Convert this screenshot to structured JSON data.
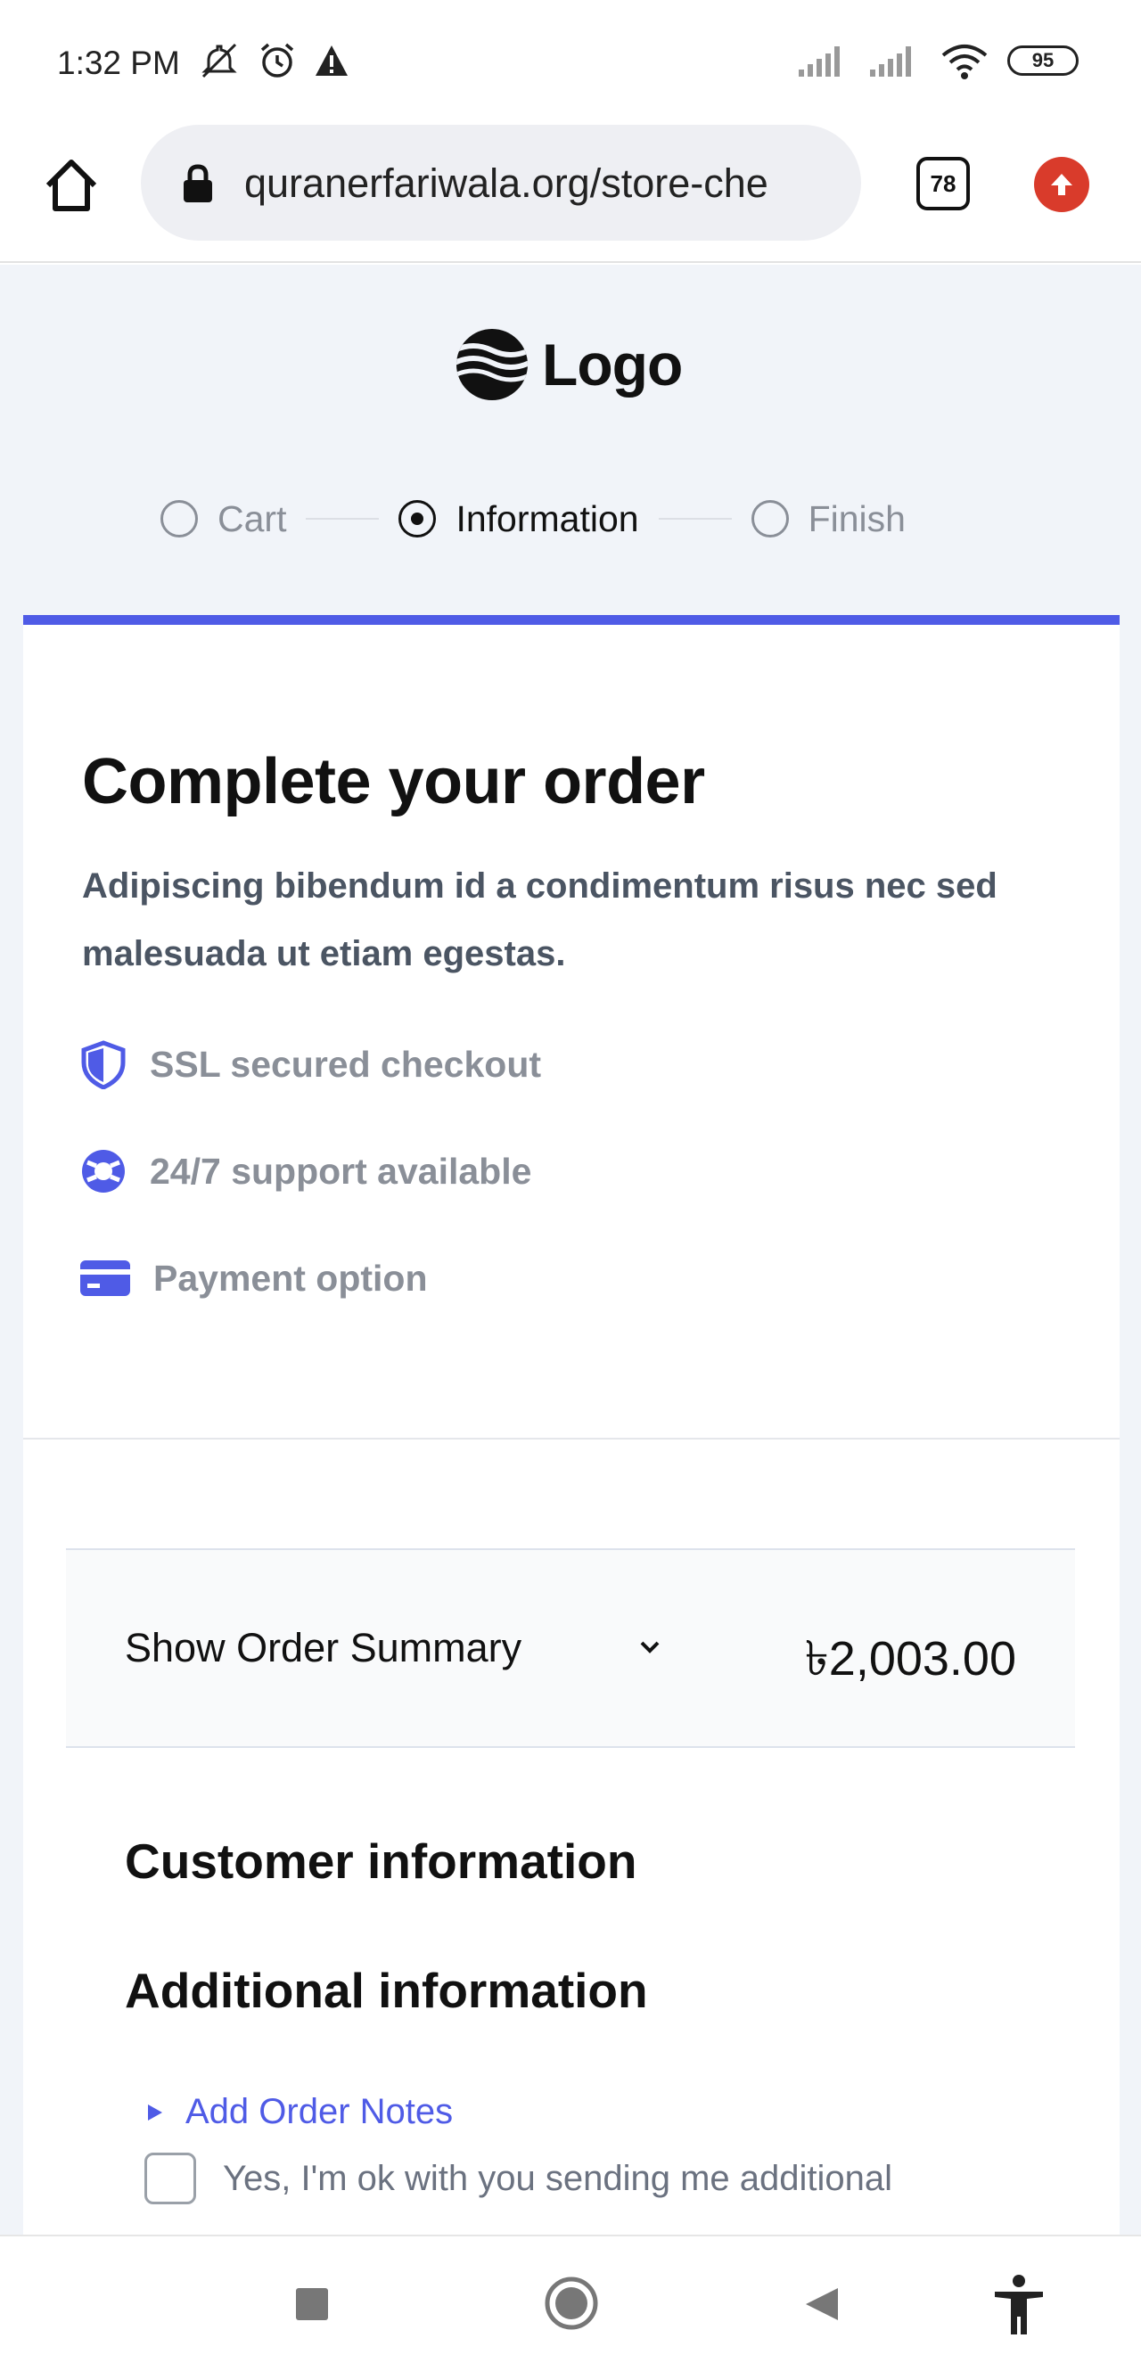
{
  "status_bar": {
    "time": "1:32 PM",
    "battery": "95"
  },
  "browser": {
    "url": "quranerfariwala.org/store-che",
    "tab_count": "78"
  },
  "logo": {
    "text": "Logo"
  },
  "steps": [
    {
      "label": "Cart",
      "active": false
    },
    {
      "label": "Information",
      "active": true
    },
    {
      "label": "Finish",
      "active": false
    }
  ],
  "checkout": {
    "title": "Complete your order",
    "subtitle": "Adipiscing bibendum id a condimentum risus nec sed malesuada ut etiam egestas.",
    "features": [
      {
        "label": "SSL secured checkout",
        "icon": "shield-icon"
      },
      {
        "label": "24/7 support available",
        "icon": "lifebuoy-icon"
      },
      {
        "label": "Payment option",
        "icon": "credit-card-icon"
      }
    ]
  },
  "summary": {
    "label": "Show Order Summary",
    "total": "৳2,003.00"
  },
  "sections": {
    "customer_info": "Customer information",
    "additional_info": "Additional information",
    "add_notes": "Add Order Notes",
    "consent": "Yes, I'm ok with you sending me additional"
  },
  "colors": {
    "accent": "#4f5be6",
    "page_bg": "#f1f4f9"
  }
}
